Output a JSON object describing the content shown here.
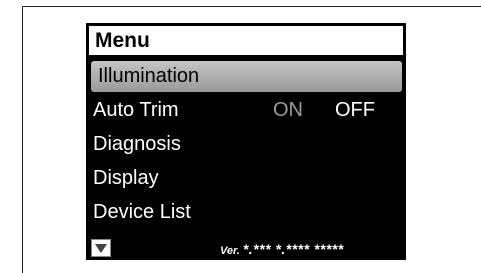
{
  "menu": {
    "title": "Menu",
    "items": [
      {
        "label": "Illumination",
        "selected": true
      },
      {
        "label": "Auto Trim",
        "options": [
          "ON",
          "OFF"
        ],
        "active_option": "OFF"
      },
      {
        "label": "Diagnosis"
      },
      {
        "label": "Display"
      },
      {
        "label": "Device List"
      }
    ]
  },
  "footer": {
    "scroll_icon": "triangle-down-icon",
    "version_prefix": "Ver.",
    "version_value": "*.*** *.**** *****"
  },
  "colors": {
    "screen_background": "#000000",
    "selection_highlight": "#b0b0b0",
    "inactive_option": "#9a9a9a",
    "text": "#ffffff"
  }
}
